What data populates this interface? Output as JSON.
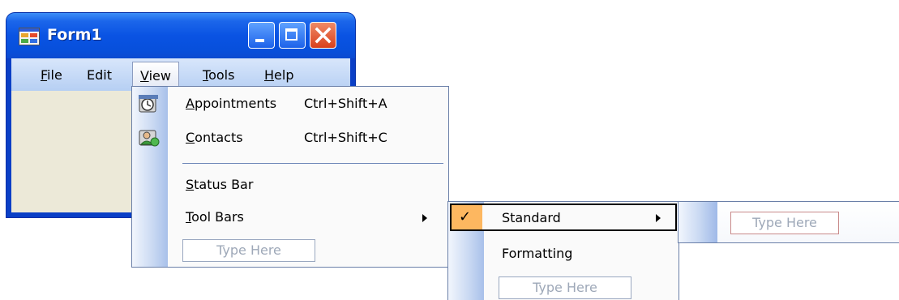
{
  "window": {
    "title": "Form1",
    "app_icon": "form-icon",
    "controls": [
      "minimize-icon",
      "maximize-icon",
      "close-icon"
    ]
  },
  "menubar": {
    "items": [
      {
        "label": "File",
        "mnemonic": "F"
      },
      {
        "label": "Edit",
        "mnemonic": ""
      },
      {
        "label": "View",
        "mnemonic": "V"
      },
      {
        "label": "Tools",
        "mnemonic": "T"
      },
      {
        "label": "Help",
        "mnemonic": "H"
      }
    ],
    "active": "View"
  },
  "view_menu": {
    "items": [
      {
        "label": "Appointments",
        "shortcut": "Ctrl+Shift+A",
        "icon": "appointments-icon"
      },
      {
        "label": "Contacts",
        "shortcut": "Ctrl+Shift+C",
        "icon": "contacts-icon"
      },
      {
        "label": "Status Bar",
        "shortcut": ""
      },
      {
        "label": "Tool Bars",
        "shortcut": "",
        "has_submenu": true
      }
    ],
    "type_here": "Type Here"
  },
  "toolbars_menu": {
    "items": [
      {
        "label": "Standard",
        "checked": true,
        "has_submenu": true
      },
      {
        "label": "Formatting",
        "checked": false
      }
    ],
    "type_here": "Type Here"
  },
  "standard_menu": {
    "type_here": "Type Here"
  },
  "colors": {
    "title_blue": "#0a53e3",
    "menubar": "#c6daf6",
    "client_bg": "#ece9d8",
    "check_highlight": "#fdb760",
    "close_red": "#d9401c"
  }
}
